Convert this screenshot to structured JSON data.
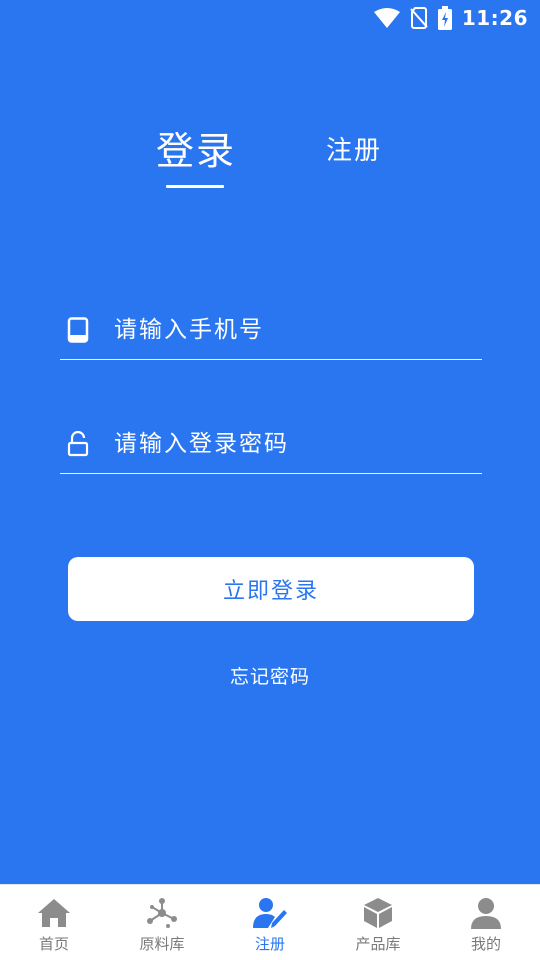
{
  "status_bar": {
    "time": "11:26",
    "icons": [
      "wifi-icon",
      "no-sim-icon",
      "battery-charging-icon"
    ]
  },
  "tabs": {
    "login": "登录",
    "register": "注册",
    "active": "login"
  },
  "form": {
    "phone": {
      "placeholder": "请输入手机号",
      "value": "",
      "icon": "phone-icon"
    },
    "password": {
      "placeholder": "请输入登录密码",
      "value": "",
      "icon": "lock-icon"
    }
  },
  "login_button": "立即登录",
  "forgot_password": "忘记密码",
  "bottom_nav": {
    "active_index": 2,
    "items": [
      {
        "label": "首页",
        "icon": "home-icon"
      },
      {
        "label": "原料库",
        "icon": "molecule-icon"
      },
      {
        "label": "注册",
        "icon": "user-edit-icon"
      },
      {
        "label": "产品库",
        "icon": "box-icon"
      },
      {
        "label": "我的",
        "icon": "person-icon"
      }
    ]
  },
  "colors": {
    "primary": "#2A76F1",
    "nav_inactive": "#7a7a7a",
    "nav_icon_inactive": "#8c8c8c",
    "white": "#FFFFFF"
  }
}
